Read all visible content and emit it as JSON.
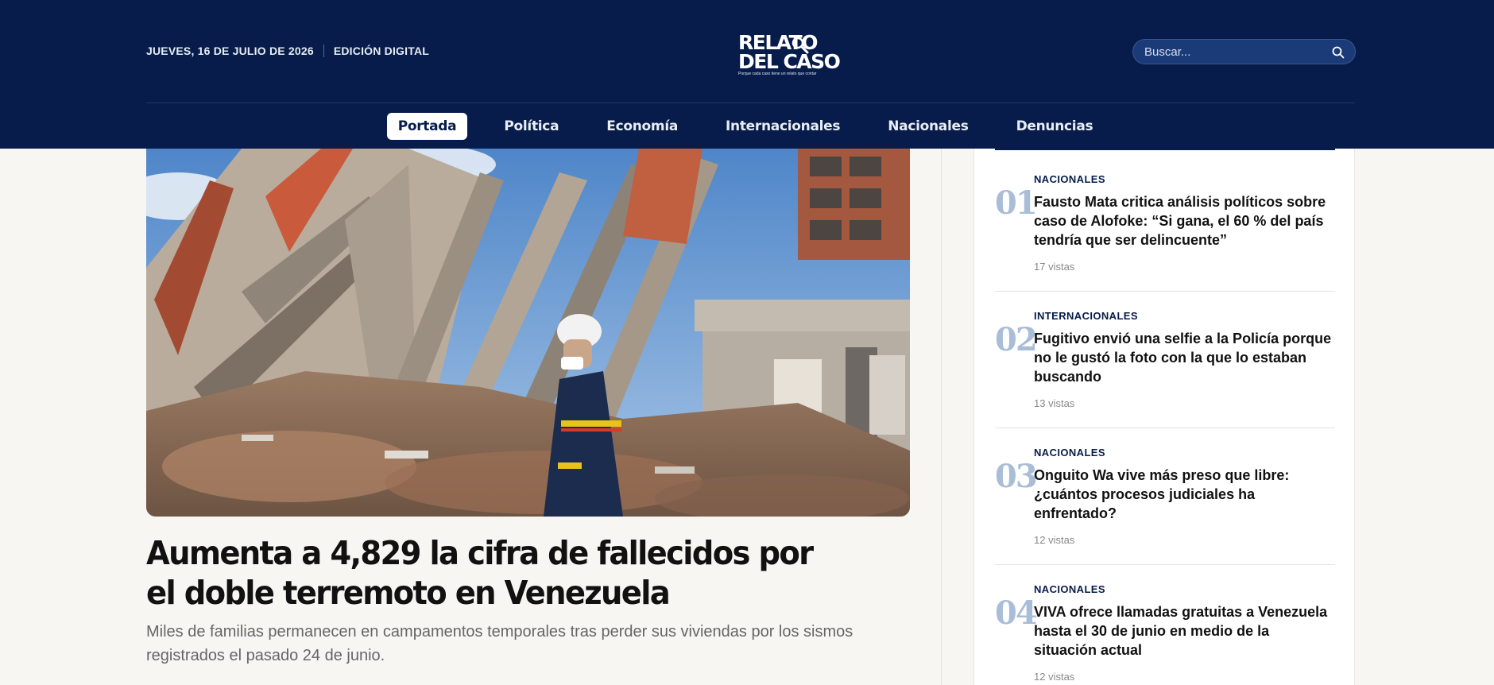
{
  "header": {
    "date": "JUEVES, 16 DE JULIO DE 2026",
    "edition": "EDICIÓN DIGITAL",
    "logo_line1": "RELATO",
    "logo_line2": "DEL CASO",
    "logo_tagline": "Porque cada caso tiene un relato que contar",
    "search_placeholder": "Buscar...",
    "bg_color": "#071c4a"
  },
  "nav": {
    "items": [
      {
        "label": "Portada",
        "active": true
      },
      {
        "label": "Política"
      },
      {
        "label": "Economía"
      },
      {
        "label": "Internacionales"
      },
      {
        "label": "Nacionales"
      },
      {
        "label": "Denuncias"
      }
    ]
  },
  "main": {
    "headline": "Aumenta a 4,829 la cifra de fallecidos por el doble terremoto en Venezuela",
    "dek": "Miles de familias permanecen en campamentos temporales tras perder sus viviendas por los sismos registrados el pasado 24 de junio."
  },
  "sidebar": {
    "items": [
      {
        "num": "01",
        "category": "NACIONALES",
        "title": "Fausto Mata critica análisis políticos sobre caso de Alofoke: “Si gana, el 60 % del país tendría que ser delincuente”",
        "views": "17 vistas"
      },
      {
        "num": "02",
        "category": "INTERNACIONALES",
        "title": "Fugitivo envió una selfie a la Policía porque no le gustó la foto con la que lo estaban buscando",
        "views": "13 vistas"
      },
      {
        "num": "03",
        "category": "NACIONALES",
        "title": "Onguito Wa vive más preso que libre: ¿cuántos procesos judiciales ha enfrentado?",
        "views": "12 vistas"
      },
      {
        "num": "04",
        "category": "NACIONALES",
        "title": "VIVA ofrece llamadas gratuitas a Venezuela hasta el 30 de junio en medio de la situación actual",
        "views": "12 vistas"
      }
    ]
  }
}
